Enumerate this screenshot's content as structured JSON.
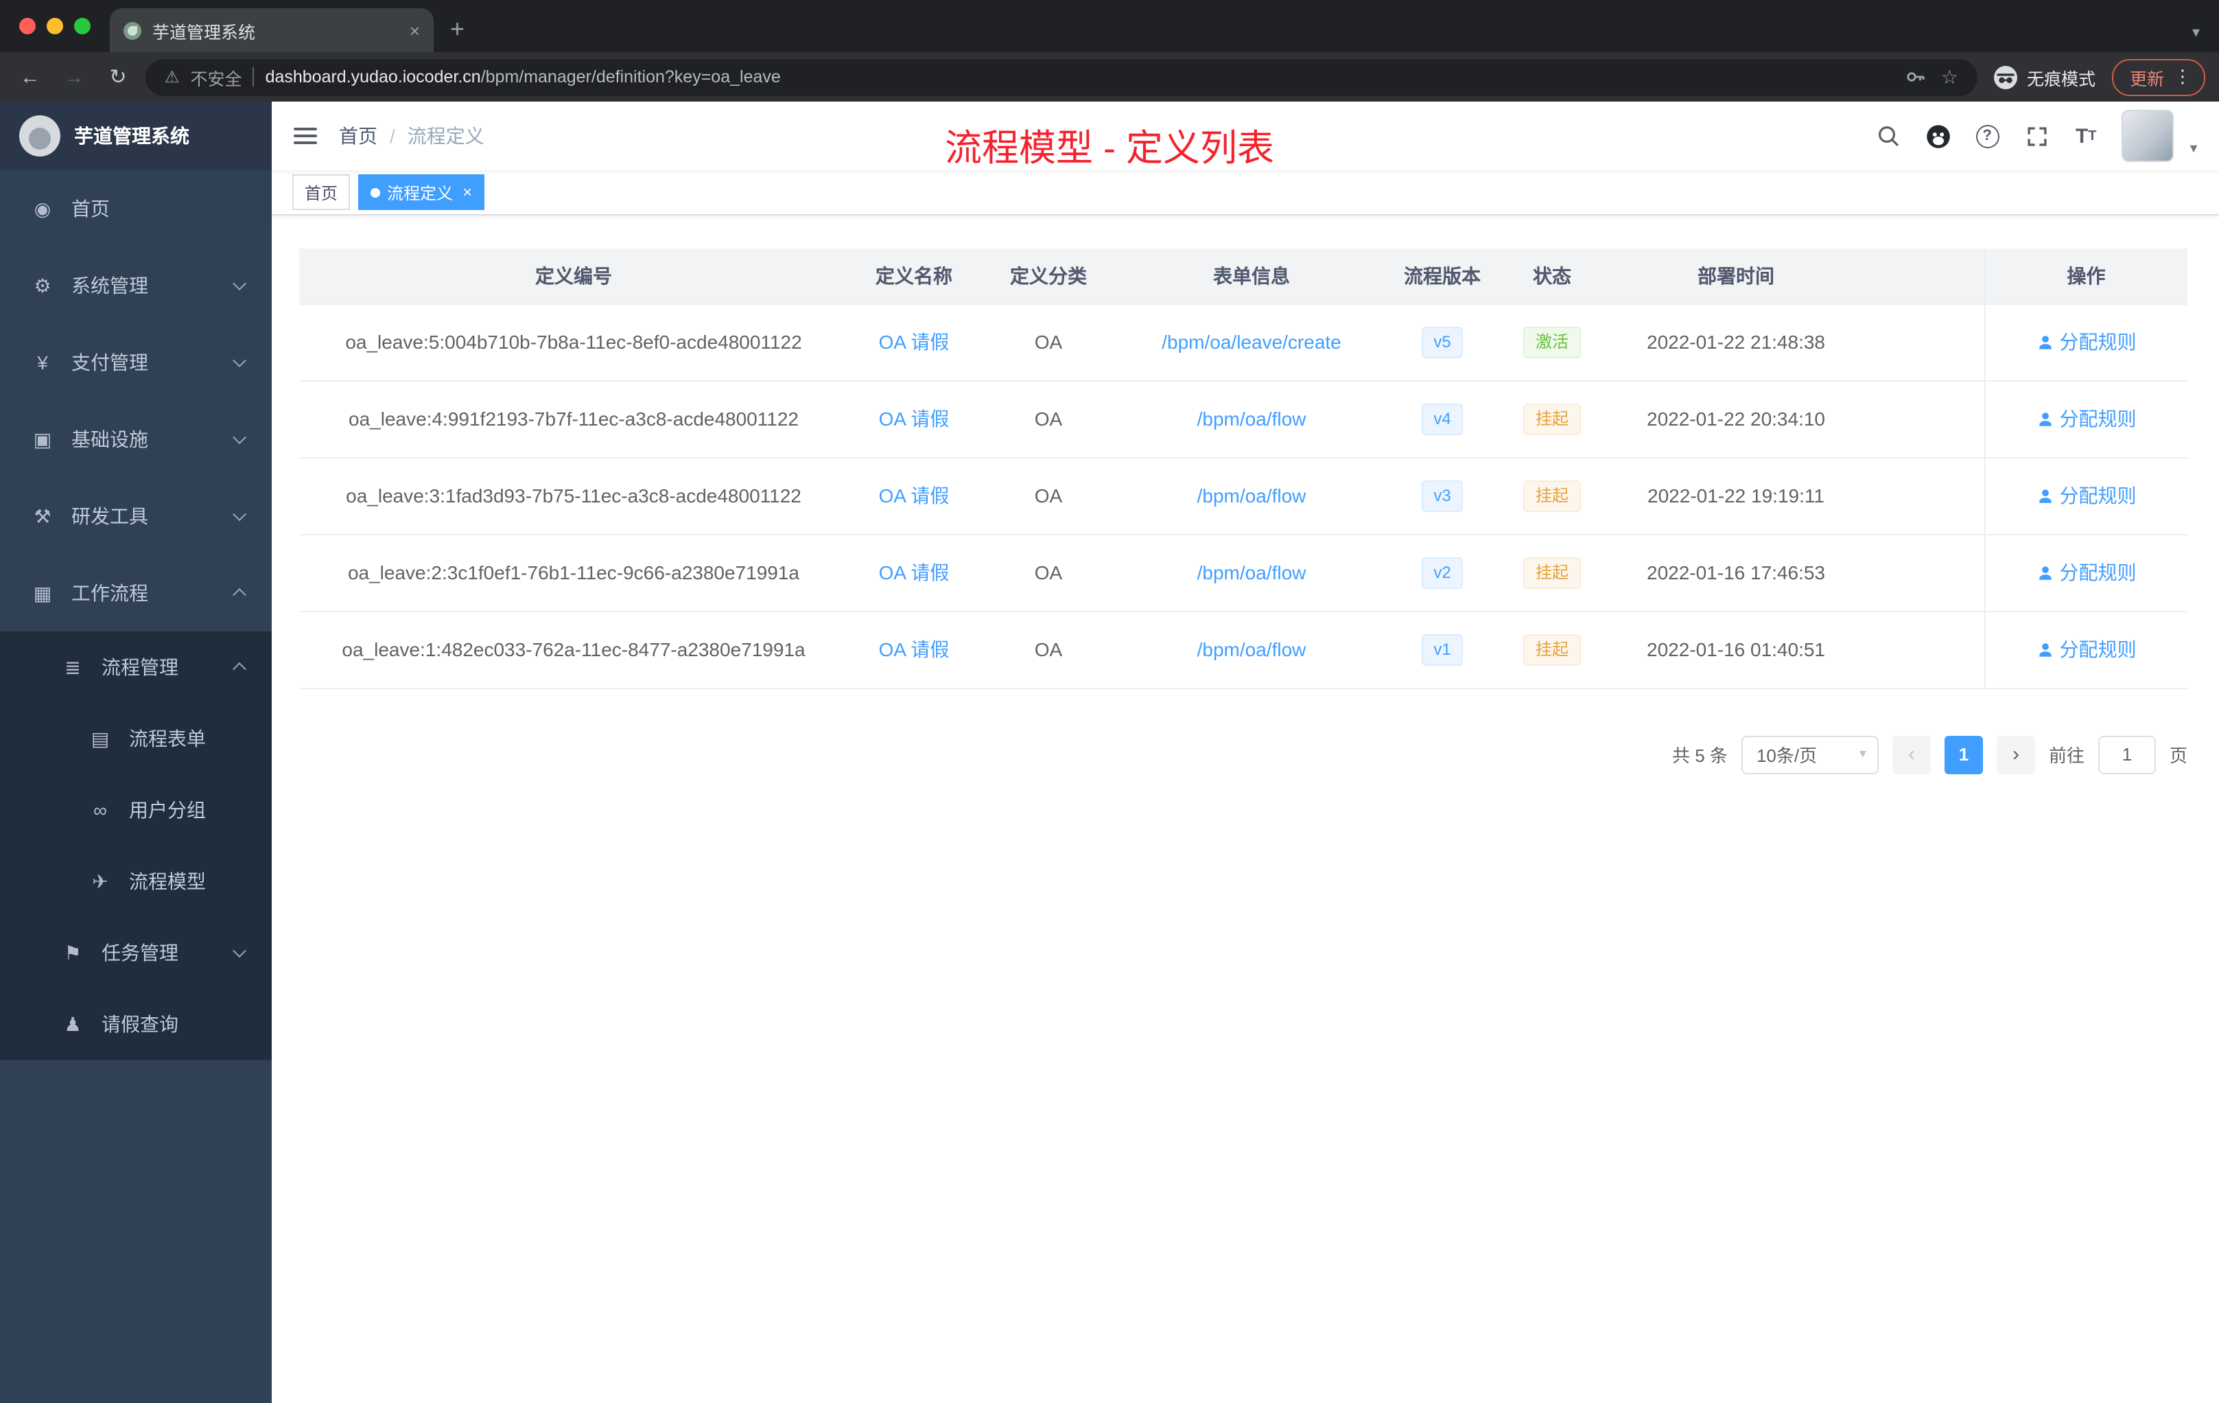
{
  "colors": {
    "accent_blue": "#409eff",
    "title_red": "#f5222d",
    "tag_success_text": "#67c23a",
    "tag_warning_text": "#e6a23c",
    "sidebar_bg": "#304156",
    "submenu_bg": "#1f2d3d"
  },
  "browser": {
    "tab_title": "芋道管理系统",
    "security_label": "不安全",
    "url_host": "dashboard.yudao.iocoder.cn",
    "url_path": "/bpm/manager/definition?key=oa_leave",
    "incognito_label": "无痕模式",
    "update_label": "更新"
  },
  "sidebar": {
    "logo_title": "芋道管理系统",
    "items": [
      {
        "label": "首页",
        "icon": "dashboard-icon",
        "glyph": "◉",
        "level": 1,
        "expanded": null
      },
      {
        "label": "系统管理",
        "icon": "gear-icon",
        "glyph": "⚙",
        "level": 1,
        "expanded": false
      },
      {
        "label": "支付管理",
        "icon": "yen-icon",
        "glyph": "¥",
        "level": 1,
        "expanded": false
      },
      {
        "label": "基础设施",
        "icon": "infrastructure-icon",
        "glyph": "▣",
        "level": 1,
        "expanded": false
      },
      {
        "label": "研发工具",
        "icon": "tools-icon",
        "glyph": "⚒",
        "level": 1,
        "expanded": false
      },
      {
        "label": "工作流程",
        "icon": "workflow-icon",
        "glyph": "▦",
        "level": 1,
        "expanded": true
      },
      {
        "label": "流程管理",
        "icon": "list-icon",
        "glyph": "≣",
        "level": 2,
        "expanded": true
      },
      {
        "label": "流程表单",
        "icon": "form-icon",
        "glyph": "▤",
        "level": 3,
        "expanded": null
      },
      {
        "label": "用户分组",
        "icon": "user-group-icon",
        "glyph": "∞",
        "level": 3,
        "expanded": null
      },
      {
        "label": "流程模型",
        "icon": "send-icon",
        "glyph": "✈",
        "level": 3,
        "expanded": null
      },
      {
        "label": "任务管理",
        "icon": "flag-icon",
        "glyph": "⚑",
        "level": 2,
        "expanded": false
      },
      {
        "label": "请假查询",
        "icon": "user-icon",
        "glyph": "♟",
        "level": 2,
        "expanded": null
      }
    ]
  },
  "header": {
    "breadcrumb": [
      "首页",
      "流程定义"
    ],
    "overlay_title": "流程模型 - 定义列表",
    "icons": [
      "search",
      "github",
      "question",
      "fullscreen",
      "font-size",
      "avatar"
    ]
  },
  "tags": [
    {
      "label": "首页",
      "active": false
    },
    {
      "label": "流程定义",
      "active": true
    }
  ],
  "table": {
    "columns": [
      "定义编号",
      "定义名称",
      "定义分类",
      "表单信息",
      "流程版本",
      "状态",
      "部署时间",
      "操作"
    ],
    "rows": [
      {
        "id": "oa_leave:5:004b710b-7b8a-11ec-8ef0-acde48001122",
        "name": "OA 请假",
        "category": "OA",
        "form": "/bpm/oa/leave/create",
        "version": "v5",
        "status": "激活",
        "status_type": "success",
        "deploy_time": "2022-01-22 21:48:38",
        "action": "分配规则"
      },
      {
        "id": "oa_leave:4:991f2193-7b7f-11ec-a3c8-acde48001122",
        "name": "OA 请假",
        "category": "OA",
        "form": "/bpm/oa/flow",
        "version": "v4",
        "status": "挂起",
        "status_type": "warning",
        "deploy_time": "2022-01-22 20:34:10",
        "action": "分配规则"
      },
      {
        "id": "oa_leave:3:1fad3d93-7b75-11ec-a3c8-acde48001122",
        "name": "OA 请假",
        "category": "OA",
        "form": "/bpm/oa/flow",
        "version": "v3",
        "status": "挂起",
        "status_type": "warning",
        "deploy_time": "2022-01-22 19:19:11",
        "action": "分配规则"
      },
      {
        "id": "oa_leave:2:3c1f0ef1-76b1-11ec-9c66-a2380e71991a",
        "name": "OA 请假",
        "category": "OA",
        "form": "/bpm/oa/flow",
        "version": "v2",
        "status": "挂起",
        "status_type": "warning",
        "deploy_time": "2022-01-16 17:46:53",
        "action": "分配规则"
      },
      {
        "id": "oa_leave:1:482ec033-762a-11ec-8477-a2380e71991a",
        "name": "OA 请假",
        "category": "OA",
        "form": "/bpm/oa/flow",
        "version": "v1",
        "status": "挂起",
        "status_type": "warning",
        "deploy_time": "2022-01-16 01:40:51",
        "action": "分配规则"
      }
    ]
  },
  "pagination": {
    "total": "共 5 条",
    "page_size": "10条/页",
    "current_page": "1",
    "goto_label": "前往",
    "goto_value": "1",
    "page_unit": "页"
  }
}
